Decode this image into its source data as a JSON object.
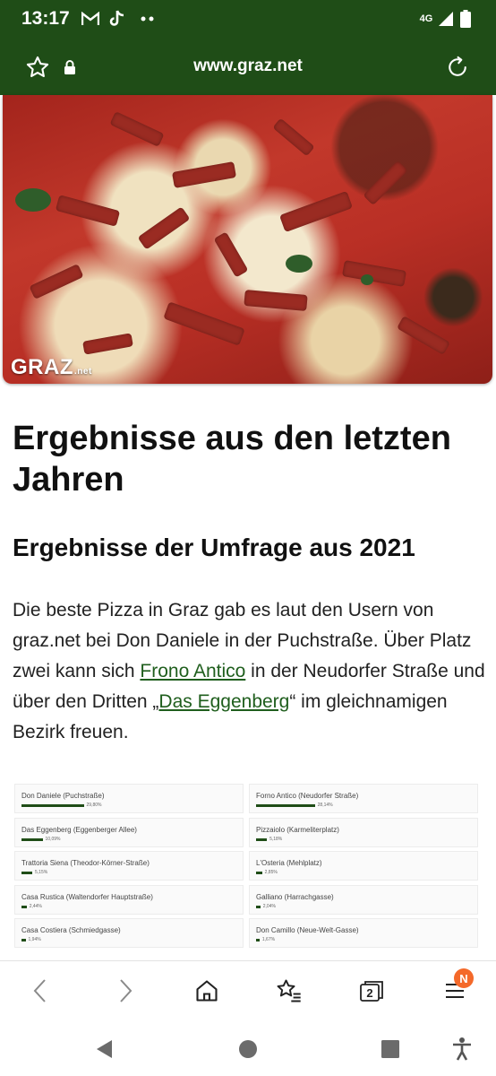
{
  "status_bar": {
    "time": "13:17",
    "left_icons": [
      "gmail-icon",
      "tiktok-icon",
      "more-dots-icon"
    ],
    "network": "4G",
    "right_icons": [
      "signal-icon",
      "battery-icon"
    ]
  },
  "browser": {
    "url": "www.graz.net",
    "icons": [
      "star-icon",
      "lock-icon",
      "reload-icon"
    ]
  },
  "hero": {
    "logo_text": "GRAZ",
    "logo_suffix": ".net"
  },
  "article": {
    "h1": "Ergebnisse aus den letzten Jahren",
    "h2": "Ergebnisse der Umfrage aus 2021",
    "p_part1": "Die beste Pizza in Graz gab es laut den Usern von graz.net bei Don Daniele in der Puchstraße. Über Platz zwei kann sich ",
    "link1": "Frono Antico",
    "p_part2": " in der Neudorfer Straße und über den Dritten „",
    "link2": "Das Eggenberg",
    "p_part3": "“ im gleichnamigen Bezirk freuen."
  },
  "results": [
    {
      "name": "Don Daniele (Puchstraße)",
      "pct_label": "29,80%",
      "pct": 29.8
    },
    {
      "name": "Forno Antico (Neudorfer Straße)",
      "pct_label": "28,14%",
      "pct": 28.14
    },
    {
      "name": "Das Eggenberg (Eggenberger Allee)",
      "pct_label": "10,09%",
      "pct": 10.09
    },
    {
      "name": "Pizzaiolo (Karmeliterplatz)",
      "pct_label": "5,18%",
      "pct": 5.18
    },
    {
      "name": "Trattoria Siena (Theodor-Körner-Straße)",
      "pct_label": "5,15%",
      "pct": 5.15
    },
    {
      "name": "L'Osteria (Mehlplatz)",
      "pct_label": "2,85%",
      "pct": 2.85
    },
    {
      "name": "Casa Rustica (Waltendorfer Hauptstraße)",
      "pct_label": "2,44%",
      "pct": 2.44
    },
    {
      "name": "Galliano (Harrachgasse)",
      "pct_label": "2,04%",
      "pct": 2.04
    },
    {
      "name": "Casa Costiera (Schmiedgasse)",
      "pct_label": "1,94%",
      "pct": 1.94
    },
    {
      "name": "Don Camillo (Neue-Welt-Gasse)",
      "pct_label": "1,67%",
      "pct": 1.67
    }
  ],
  "bottom_nav": {
    "tabs_count": "2",
    "menu_badge": "N",
    "icons": [
      "back-icon",
      "forward-icon",
      "home-icon",
      "bookmarks-icon",
      "tabs-icon",
      "menu-icon"
    ]
  },
  "system_nav": {
    "icons": [
      "system-back-icon",
      "system-home-icon",
      "system-recents-icon",
      "accessibility-icon"
    ]
  },
  "colors": {
    "brand_green": "#1f4d17",
    "link_green": "#1f5e1d",
    "badge_orange": "#f4692a"
  }
}
